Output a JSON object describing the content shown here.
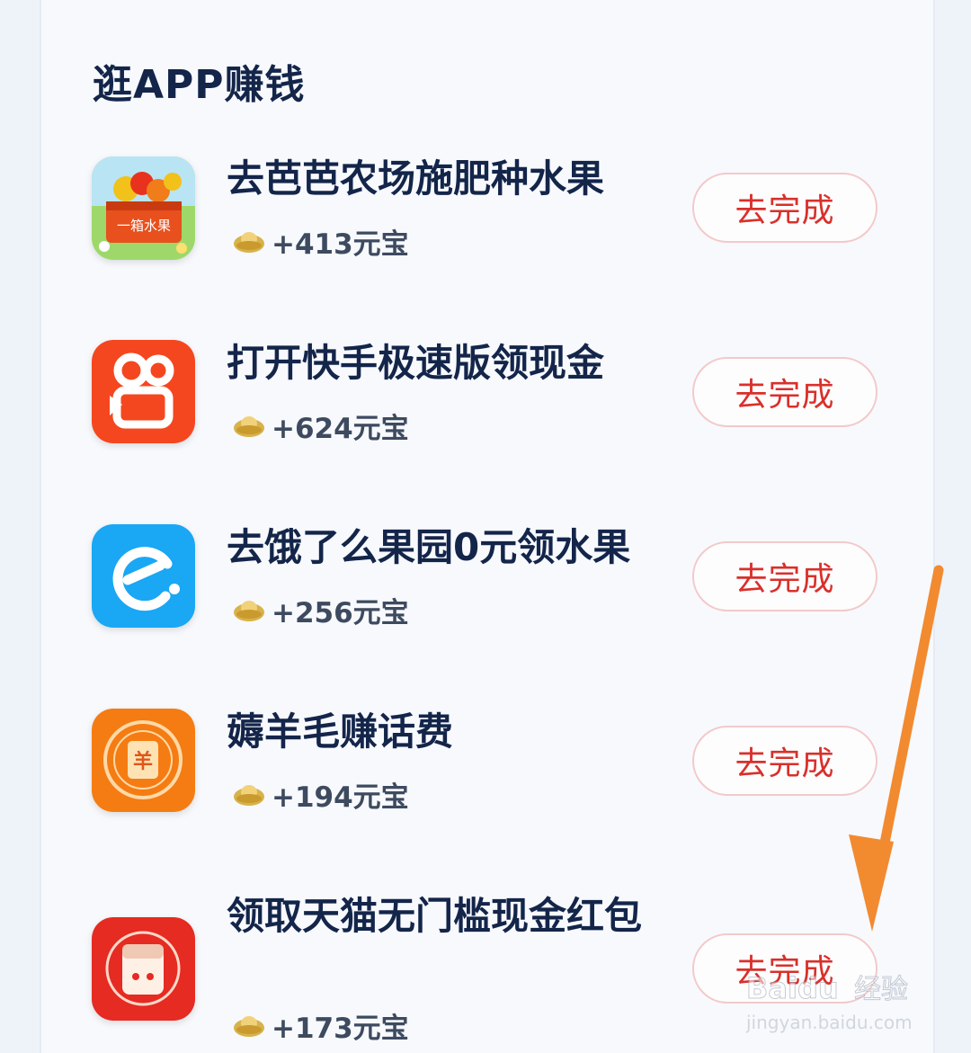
{
  "section": {
    "title": "逛APP赚钱"
  },
  "tasks": [
    {
      "title": "去芭芭农场施肥种水果",
      "reward": "+413元宝",
      "button": "去完成",
      "icon": "fruit-box-icon",
      "icon_text": "一箱水果"
    },
    {
      "title": "打开快手极速版领现金",
      "reward": "+624元宝",
      "button": "去完成",
      "icon": "kuaishou-icon"
    },
    {
      "title": "去饿了么果园0元领水果",
      "reward": "+256元宝",
      "button": "去完成",
      "icon": "eleme-icon"
    },
    {
      "title": "薅羊毛赚话费",
      "reward": "+194元宝",
      "button": "去完成",
      "icon": "coin-icon",
      "icon_text": "羊"
    },
    {
      "title": "领取天猫无门槛现金红包",
      "reward": "+173元宝",
      "button": "去完成",
      "icon": "tmall-redpacket-icon"
    }
  ],
  "watermark": {
    "brand": "Baidu",
    "product": "经验",
    "url": "jingyan.baidu.com"
  },
  "colors": {
    "accent": "#d9302b",
    "title": "#14254a",
    "arrow": "#f28a30"
  }
}
